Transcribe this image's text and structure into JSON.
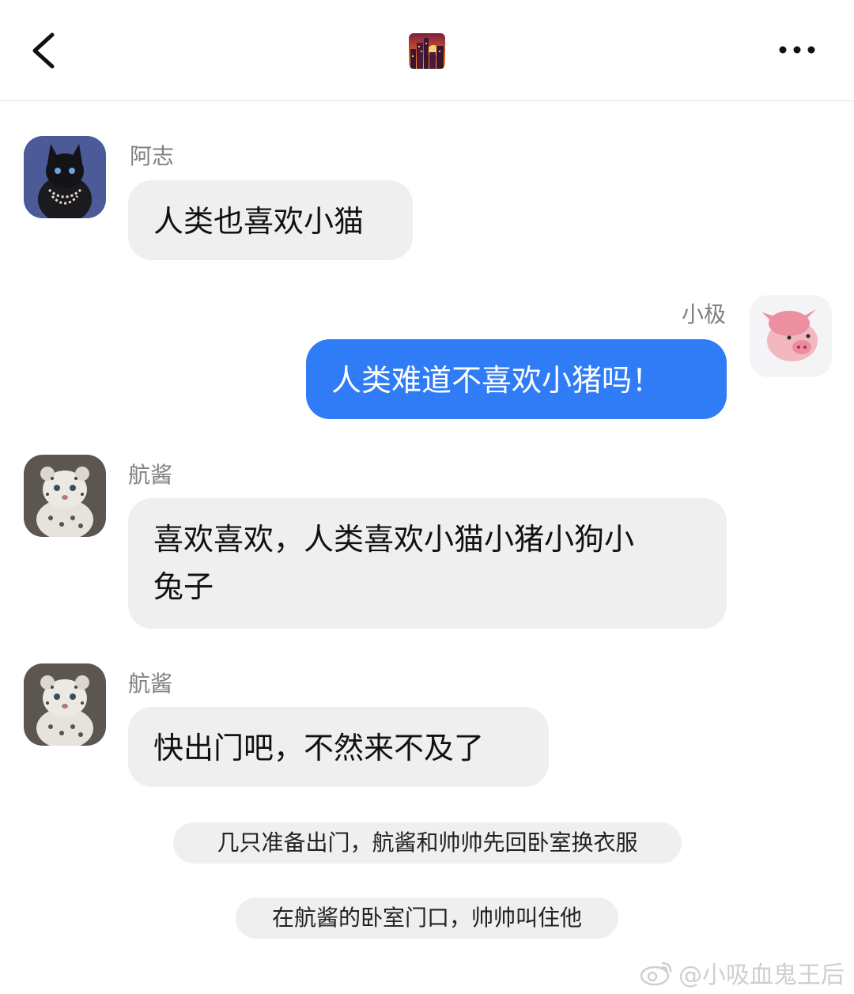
{
  "header": {
    "back_icon": "chevron-left-icon",
    "logo_icon": "city-sunset-icon",
    "more_icon": "ellipsis-icon"
  },
  "messages": [
    {
      "sender": "阿志",
      "text": "人类也喜欢小猫",
      "side": "left",
      "avatar": "black-kitten-avatar"
    },
    {
      "sender": "小极",
      "text": "人类难道不喜欢小猪吗！",
      "side": "right",
      "avatar": "pink-piglet-avatar"
    },
    {
      "sender": "航酱",
      "text": "喜欢喜欢，人类喜欢小猫小猪小狗小兔子",
      "line1": "喜欢喜欢，人类喜欢小猫小猪小狗小",
      "line2": "兔子",
      "side": "left",
      "avatar": "snow-leopard-cub-avatar"
    },
    {
      "sender": "航酱",
      "text": "快出门吧，不然来不及了",
      "side": "left",
      "avatar": "snow-leopard-cub-avatar"
    }
  ],
  "narrations": [
    "几只准备出门，航酱和帅帅先回卧室换衣服",
    "在航酱的卧室门口，帅帅叫住他"
  ],
  "watermark": {
    "text": "@小吸血鬼王后",
    "icon": "weibo-icon"
  },
  "colors": {
    "accent_bubble": "#2f7cf6",
    "incoming_bubble": "#efefef",
    "sender_text": "#808080"
  }
}
